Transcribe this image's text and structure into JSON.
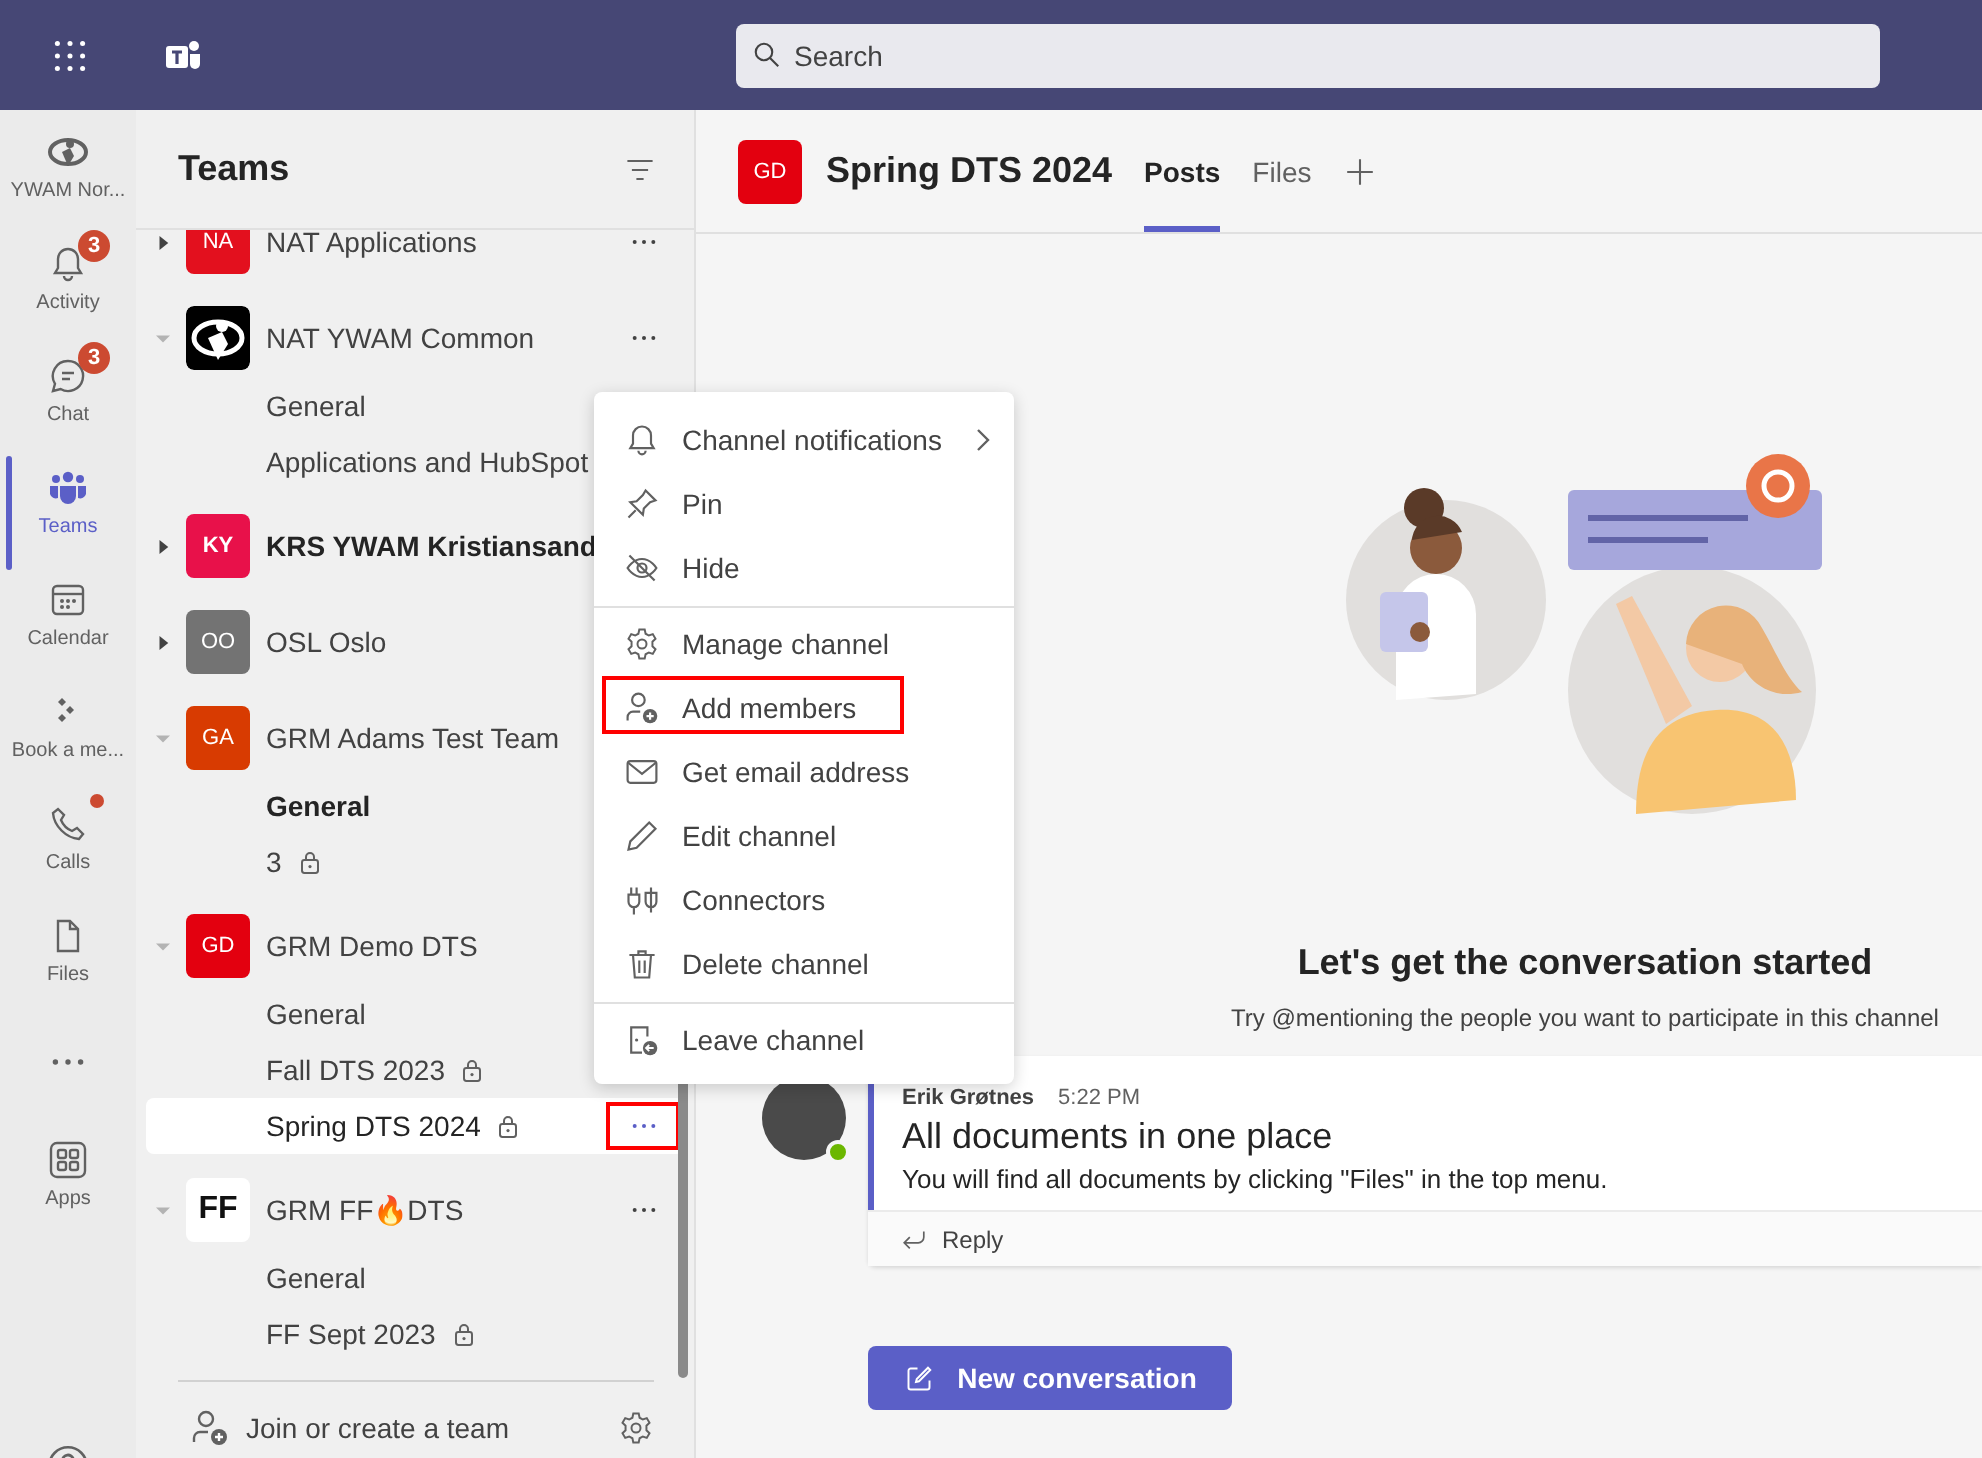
{
  "app_bar": {
    "search": {
      "placeholder": "Search"
    }
  },
  "rail": {
    "items": [
      {
        "label": "YWAM Nor...",
        "dot": false,
        "selected": false
      },
      {
        "label": "Activity",
        "badge": "3",
        "dot": false,
        "selected": false
      },
      {
        "label": "Chat",
        "badge": "3",
        "dot": false,
        "selected": false
      },
      {
        "label": "Teams",
        "dot": false,
        "selected": true
      },
      {
        "label": "Calendar",
        "dot": false,
        "selected": false
      },
      {
        "label": "Book a me...",
        "dot": false,
        "selected": false
      },
      {
        "label": "Calls",
        "dot": true,
        "selected": false
      },
      {
        "label": "Files",
        "dot": false,
        "selected": false
      },
      {
        "dot": false,
        "selected": false
      },
      {
        "label": "Apps",
        "dot": false,
        "selected": false
      }
    ]
  },
  "teams_panel": {
    "title": "Teams",
    "teams": [
      {
        "name": "NAT Applications",
        "bold": false,
        "expanded": false,
        "more": true,
        "avatar": {
          "kind": "initials",
          "text": "NA",
          "color": "#e3101e"
        }
      },
      {
        "name": "NAT YWAM Common",
        "bold": false,
        "expanded": true,
        "more": true,
        "avatar": {
          "kind": "logo",
          "color": "#000000"
        },
        "channels": [
          {
            "name": "General",
            "bold": false,
            "private": false,
            "selected": false
          },
          {
            "name": "Applications and HubSpot",
            "bold": false,
            "private": false,
            "selected": false
          }
        ]
      },
      {
        "name": "KRS YWAM Kristiansand",
        "bold": true,
        "expanded": false,
        "avatar": {
          "kind": "initials",
          "text": "KY",
          "color": "#e8114a"
        }
      },
      {
        "name": "OSL Oslo",
        "bold": false,
        "expanded": false,
        "avatar": {
          "kind": "initials",
          "text": "OO",
          "color": "#737373"
        }
      },
      {
        "name": "GRM Adams Test Team",
        "bold": false,
        "expanded": true,
        "avatar": {
          "kind": "initials",
          "text": "GA",
          "color": "#d83b01"
        },
        "channels": [
          {
            "name": "General",
            "bold": true,
            "private": false,
            "selected": false
          },
          {
            "name": "3",
            "bold": false,
            "private": true,
            "selected": false
          }
        ]
      },
      {
        "name": "GRM Demo DTS",
        "bold": false,
        "expanded": true,
        "avatar": {
          "kind": "initials",
          "text": "GD",
          "color": "#e3000f"
        },
        "channels": [
          {
            "name": "General",
            "bold": false,
            "private": false,
            "selected": false
          },
          {
            "name": "Fall DTS 2023",
            "bold": false,
            "private": true,
            "selected": false
          },
          {
            "name": "Spring DTS 2024",
            "bold": false,
            "private": true,
            "selected": true,
            "more": true,
            "highlighted": true
          }
        ]
      },
      {
        "name": "GRM FF🔥DTS",
        "bold": false,
        "expanded": true,
        "more": true,
        "avatar": {
          "kind": "letters",
          "text": "FF",
          "color": "#ffffff"
        },
        "channels": [
          {
            "name": "General",
            "bold": false,
            "private": false,
            "selected": false
          },
          {
            "name": "FF Sept 2023",
            "bold": false,
            "private": true,
            "selected": false
          }
        ]
      }
    ],
    "footer": {
      "label": "Join or create a team"
    }
  },
  "context_menu": {
    "groups": [
      [
        {
          "label": "Channel notifications",
          "submenu": true,
          "highlighted": false
        },
        {
          "label": "Pin",
          "submenu": false,
          "highlighted": false
        },
        {
          "label": "Hide",
          "submenu": false,
          "highlighted": false
        }
      ],
      [
        {
          "label": "Manage channel",
          "submenu": false,
          "highlighted": false
        },
        {
          "label": "Add members",
          "submenu": false,
          "highlighted": true
        },
        {
          "label": "Get email address",
          "submenu": false,
          "highlighted": false
        },
        {
          "label": "Edit channel",
          "submenu": false,
          "highlighted": false
        },
        {
          "label": "Connectors",
          "submenu": false,
          "highlighted": false
        },
        {
          "label": "Delete channel",
          "submenu": false,
          "highlighted": false
        }
      ],
      [
        {
          "label": "Leave channel",
          "submenu": false,
          "highlighted": false
        }
      ]
    ]
  },
  "channel_header": {
    "avatar": {
      "text": "GD",
      "color": "#e3000f"
    },
    "title": "Spring DTS 2024",
    "tabs": [
      {
        "label": "Posts",
        "selected": true
      },
      {
        "label": "Files",
        "selected": false
      }
    ]
  },
  "empty_state": {
    "heading": "Let's get the conversation started",
    "hint": "Try @mentioning the people you want to participate in this channel"
  },
  "messages": [
    {
      "author": "Erik Grøtnes",
      "time": "5:22 PM",
      "subject": "All documents in one place",
      "body": "You will find all documents by clicking \"Files\" in the top menu.",
      "online": true,
      "reply": "Reply"
    }
  ],
  "new_conversation": {
    "label": "New conversation"
  }
}
